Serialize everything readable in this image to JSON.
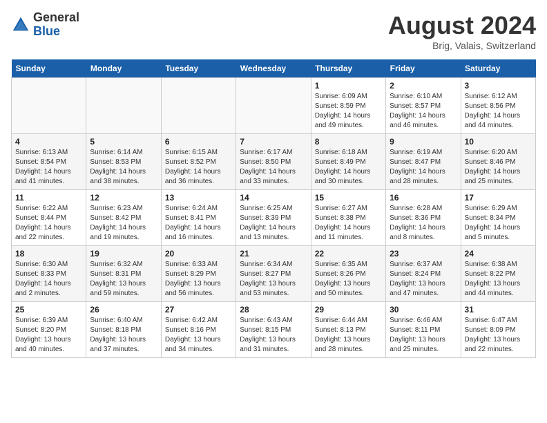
{
  "logo": {
    "line1": "General",
    "line2": "Blue"
  },
  "title": "August 2024",
  "subtitle": "Brig, Valais, Switzerland",
  "days_of_week": [
    "Sunday",
    "Monday",
    "Tuesday",
    "Wednesday",
    "Thursday",
    "Friday",
    "Saturday"
  ],
  "weeks": [
    [
      {
        "day": "",
        "info": ""
      },
      {
        "day": "",
        "info": ""
      },
      {
        "day": "",
        "info": ""
      },
      {
        "day": "",
        "info": ""
      },
      {
        "day": "1",
        "info": "Sunrise: 6:09 AM\nSunset: 8:59 PM\nDaylight: 14 hours\nand 49 minutes."
      },
      {
        "day": "2",
        "info": "Sunrise: 6:10 AM\nSunset: 8:57 PM\nDaylight: 14 hours\nand 46 minutes."
      },
      {
        "day": "3",
        "info": "Sunrise: 6:12 AM\nSunset: 8:56 PM\nDaylight: 14 hours\nand 44 minutes."
      }
    ],
    [
      {
        "day": "4",
        "info": "Sunrise: 6:13 AM\nSunset: 8:54 PM\nDaylight: 14 hours\nand 41 minutes."
      },
      {
        "day": "5",
        "info": "Sunrise: 6:14 AM\nSunset: 8:53 PM\nDaylight: 14 hours\nand 38 minutes."
      },
      {
        "day": "6",
        "info": "Sunrise: 6:15 AM\nSunset: 8:52 PM\nDaylight: 14 hours\nand 36 minutes."
      },
      {
        "day": "7",
        "info": "Sunrise: 6:17 AM\nSunset: 8:50 PM\nDaylight: 14 hours\nand 33 minutes."
      },
      {
        "day": "8",
        "info": "Sunrise: 6:18 AM\nSunset: 8:49 PM\nDaylight: 14 hours\nand 30 minutes."
      },
      {
        "day": "9",
        "info": "Sunrise: 6:19 AM\nSunset: 8:47 PM\nDaylight: 14 hours\nand 28 minutes."
      },
      {
        "day": "10",
        "info": "Sunrise: 6:20 AM\nSunset: 8:46 PM\nDaylight: 14 hours\nand 25 minutes."
      }
    ],
    [
      {
        "day": "11",
        "info": "Sunrise: 6:22 AM\nSunset: 8:44 PM\nDaylight: 14 hours\nand 22 minutes."
      },
      {
        "day": "12",
        "info": "Sunrise: 6:23 AM\nSunset: 8:42 PM\nDaylight: 14 hours\nand 19 minutes."
      },
      {
        "day": "13",
        "info": "Sunrise: 6:24 AM\nSunset: 8:41 PM\nDaylight: 14 hours\nand 16 minutes."
      },
      {
        "day": "14",
        "info": "Sunrise: 6:25 AM\nSunset: 8:39 PM\nDaylight: 14 hours\nand 13 minutes."
      },
      {
        "day": "15",
        "info": "Sunrise: 6:27 AM\nSunset: 8:38 PM\nDaylight: 14 hours\nand 11 minutes."
      },
      {
        "day": "16",
        "info": "Sunrise: 6:28 AM\nSunset: 8:36 PM\nDaylight: 14 hours\nand 8 minutes."
      },
      {
        "day": "17",
        "info": "Sunrise: 6:29 AM\nSunset: 8:34 PM\nDaylight: 14 hours\nand 5 minutes."
      }
    ],
    [
      {
        "day": "18",
        "info": "Sunrise: 6:30 AM\nSunset: 8:33 PM\nDaylight: 14 hours\nand 2 minutes."
      },
      {
        "day": "19",
        "info": "Sunrise: 6:32 AM\nSunset: 8:31 PM\nDaylight: 13 hours\nand 59 minutes."
      },
      {
        "day": "20",
        "info": "Sunrise: 6:33 AM\nSunset: 8:29 PM\nDaylight: 13 hours\nand 56 minutes."
      },
      {
        "day": "21",
        "info": "Sunrise: 6:34 AM\nSunset: 8:27 PM\nDaylight: 13 hours\nand 53 minutes."
      },
      {
        "day": "22",
        "info": "Sunrise: 6:35 AM\nSunset: 8:26 PM\nDaylight: 13 hours\nand 50 minutes."
      },
      {
        "day": "23",
        "info": "Sunrise: 6:37 AM\nSunset: 8:24 PM\nDaylight: 13 hours\nand 47 minutes."
      },
      {
        "day": "24",
        "info": "Sunrise: 6:38 AM\nSunset: 8:22 PM\nDaylight: 13 hours\nand 44 minutes."
      }
    ],
    [
      {
        "day": "25",
        "info": "Sunrise: 6:39 AM\nSunset: 8:20 PM\nDaylight: 13 hours\nand 40 minutes."
      },
      {
        "day": "26",
        "info": "Sunrise: 6:40 AM\nSunset: 8:18 PM\nDaylight: 13 hours\nand 37 minutes."
      },
      {
        "day": "27",
        "info": "Sunrise: 6:42 AM\nSunset: 8:16 PM\nDaylight: 13 hours\nand 34 minutes."
      },
      {
        "day": "28",
        "info": "Sunrise: 6:43 AM\nSunset: 8:15 PM\nDaylight: 13 hours\nand 31 minutes."
      },
      {
        "day": "29",
        "info": "Sunrise: 6:44 AM\nSunset: 8:13 PM\nDaylight: 13 hours\nand 28 minutes."
      },
      {
        "day": "30",
        "info": "Sunrise: 6:46 AM\nSunset: 8:11 PM\nDaylight: 13 hours\nand 25 minutes."
      },
      {
        "day": "31",
        "info": "Sunrise: 6:47 AM\nSunset: 8:09 PM\nDaylight: 13 hours\nand 22 minutes."
      }
    ]
  ]
}
